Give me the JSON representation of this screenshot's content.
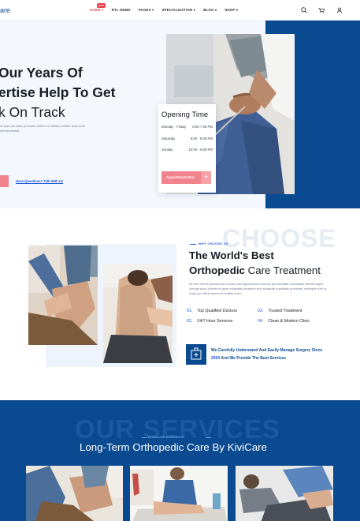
{
  "brand": {
    "logo_text": "are"
  },
  "nav": {
    "items": [
      {
        "label": "HOME",
        "active": true,
        "badge": "HOT"
      },
      {
        "label": "RTL DEMO"
      },
      {
        "label": "PAGES"
      },
      {
        "label": "SPECIALIZATION"
      },
      {
        "label": "BLOG"
      },
      {
        "label": "SHOP"
      }
    ],
    "icons": [
      "search-icon",
      "cart-icon",
      "user-icon"
    ]
  },
  "hero": {
    "title_line1": "Our Years Of",
    "title_line2": "ertise Help To Get",
    "title_line3": "k On Track",
    "subtitle": "of work we have provided 1000's of clients a better overcome mental illness",
    "link_text": "Have Questions? Talk With Us",
    "opening_hours": {
      "title": "Opening Time",
      "rows": [
        {
          "day": "Monday - Friday",
          "time": "6:00-7:00 PM"
        },
        {
          "day": "Saturday",
          "time": "9:00 - 8:00 PM"
        },
        {
          "day": "Sunday",
          "time": "10:00 - 9:00 PM"
        }
      ],
      "button_label": "Appointment Now",
      "button_icon": "+"
    }
  },
  "choose": {
    "tag": "WHY CHOOSE US",
    "watermark": "CHOOSE",
    "title_line1": "The World's Best",
    "title_bold": "Orthopedic",
    "title_light": " Care Treatment",
    "description": "At vero eos et accusamus et iusto odio dignissimos ducimus qui blanditiis voluptatum deleniti atque corrupti quos dolores et quas molestias excepturi sint occaecati cupiditate provident, similique sunt in culpa qui officia deserunt mollitia anim.",
    "features": [
      {
        "num": "01.",
        "label": "Top Qualified Doctors"
      },
      {
        "num": "03.",
        "label": "Trusted Treatment"
      },
      {
        "num": "02.",
        "label": "24/7 Hour Services"
      },
      {
        "num": "04.",
        "label": "Clean & Modern Clinic"
      }
    ],
    "callout_pre": "We Carefully Understand And Easily Manage Surgery Since",
    "callout_year": "2000",
    "callout_post": "And We Provide The Best Services"
  },
  "services": {
    "watermark": "OUR SERVICES",
    "tag": "KIVICARE SERVICES",
    "title": "Long-Term Orthopedic Care By KiviCare"
  },
  "colors": {
    "primary": "#0a4a91",
    "accent": "#1c59d6",
    "pink": "#f0838b",
    "hot": "#e8434d",
    "hero_bg": "#f4f8fc"
  }
}
